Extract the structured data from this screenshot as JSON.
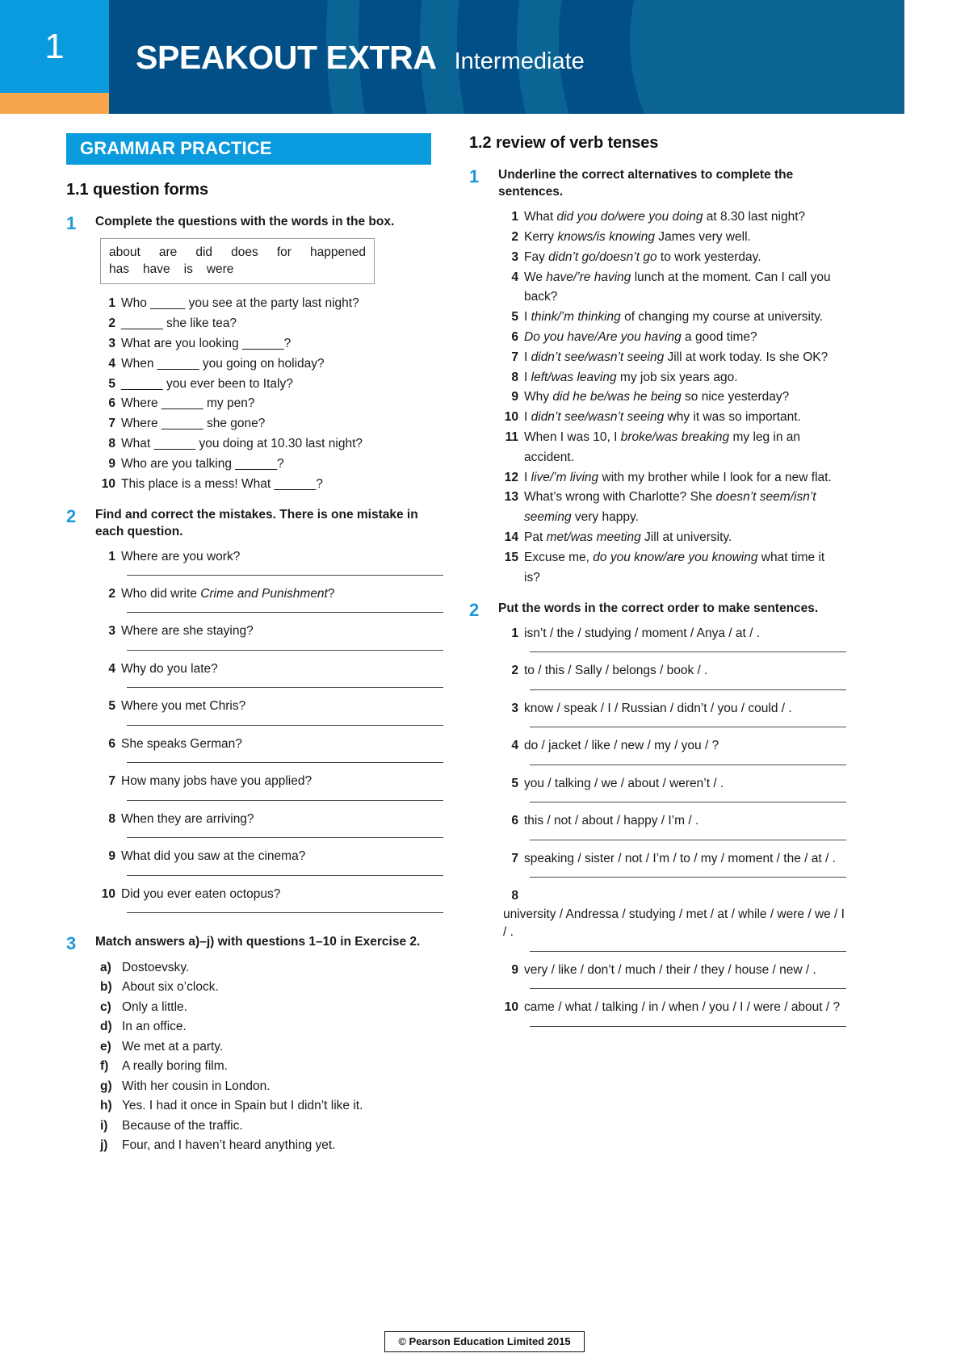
{
  "header": {
    "chapter_number": "1",
    "brand": "SPEAKOUT EXTRA",
    "level": "Intermediate",
    "accent_blue": "#0a9ade",
    "header_blue": "#014f86",
    "accent_orange": "#f7a64b"
  },
  "left_column": {
    "banner": "GRAMMAR PRACTICE",
    "unit_title": "1.1 question forms",
    "exercise1": {
      "number": "1",
      "instruction": "Complete the questions with the words in the box.",
      "wordbox_row1": [
        "about",
        "are",
        "did",
        "does",
        "for",
        "happened"
      ],
      "wordbox_row2": [
        "has",
        "have",
        "is",
        "were"
      ],
      "items": [
        {
          "n": "1",
          "text": "Who _____ you see at the party last night?"
        },
        {
          "n": "2",
          "text": "______ she like tea?"
        },
        {
          "n": "3",
          "text": "What are you looking ______?"
        },
        {
          "n": "4",
          "text": "When ______ you going on holiday?"
        },
        {
          "n": "5",
          "text": "______ you ever been to Italy?"
        },
        {
          "n": "6",
          "text": "Where ______ my pen?"
        },
        {
          "n": "7",
          "text": "Where ______ she gone?"
        },
        {
          "n": "8",
          "text": "What ______ you doing at 10.30 last night?"
        },
        {
          "n": "9",
          "text": "Who are you talking ______?"
        },
        {
          "n": "10",
          "text": "This place is a mess! What ______?"
        }
      ]
    },
    "exercise2": {
      "number": "2",
      "instruction": "Find and correct the mistakes. There is one mistake in each question.",
      "items": [
        {
          "n": "1",
          "text": "Where are you work?"
        },
        {
          "n": "2",
          "text": "Who did write ",
          "italic": "Crime and Punishment",
          "tail": "?"
        },
        {
          "n": "3",
          "text": "Where are she staying?"
        },
        {
          "n": "4",
          "text": "Why do you late?"
        },
        {
          "n": "5",
          "text": "Where you met Chris?"
        },
        {
          "n": "6",
          "text": "She speaks German?"
        },
        {
          "n": "7",
          "text": "How many jobs have you applied?"
        },
        {
          "n": "8",
          "text": "When they are arriving?"
        },
        {
          "n": "9",
          "text": "What did you saw at the cinema?"
        },
        {
          "n": "10",
          "text": "Did you ever eaten octopus?"
        }
      ]
    },
    "exercise3": {
      "number": "3",
      "instruction": "Match answers a)–j) with questions 1–10 in Exercise 2.",
      "items": [
        {
          "n": "a)",
          "text": "Dostoevsky."
        },
        {
          "n": "b)",
          "text": "About six o’clock."
        },
        {
          "n": "c)",
          "text": "Only a little."
        },
        {
          "n": "d)",
          "text": "In an office."
        },
        {
          "n": "e)",
          "text": "We met at a party."
        },
        {
          "n": "f)",
          "text": "A really boring film."
        },
        {
          "n": "g)",
          "text": "With her cousin in London."
        },
        {
          "n": "h)",
          "text": "Yes. I had it once in Spain but I didn’t like it."
        },
        {
          "n": "i)",
          "text": "Because of the traffic."
        },
        {
          "n": "j)",
          "text": "Four, and I haven’t heard anything yet."
        }
      ]
    }
  },
  "right_column": {
    "unit_title": "1.2 review of verb tenses",
    "exercise1": {
      "number": "1",
      "instruction": "Underline the correct alternatives to complete the sentences.",
      "items": [
        {
          "n": "1",
          "pre": "What ",
          "italic": "did you do/were you doing",
          "post": " at 8.30 last night?"
        },
        {
          "n": "2",
          "pre": "Kerry ",
          "italic": "knows/is knowing",
          "post": " James very well."
        },
        {
          "n": "3",
          "pre": "Fay ",
          "italic": "didn’t go/doesn’t go",
          "post": " to work yesterday."
        },
        {
          "n": "4",
          "pre": "We ",
          "italic": "have/’re having",
          "post": " lunch at the moment. Can I call you back?"
        },
        {
          "n": "5",
          "pre": "I ",
          "italic": "think/’m thinking",
          "post": " of changing my course at university."
        },
        {
          "n": "6",
          "pre": "",
          "italic": "Do you have/Are you having",
          "post": " a good time?"
        },
        {
          "n": "7",
          "pre": "I ",
          "italic": "didn’t see/wasn’t seeing",
          "post": " Jill at work today. Is she OK?"
        },
        {
          "n": "8",
          "pre": "I ",
          "italic": "left/was leaving",
          "post": " my job six years ago."
        },
        {
          "n": "9",
          "pre": "Why ",
          "italic": "did he be/was he being",
          "post": " so nice yesterday?"
        },
        {
          "n": "10",
          "pre": "I ",
          "italic": "didn’t see/wasn’t seeing",
          "post": " why it was so important."
        },
        {
          "n": "11",
          "pre": "When I was 10, I ",
          "italic": "broke/was breaking",
          "post": " my leg in an accident."
        },
        {
          "n": "12",
          "pre": "I ",
          "italic": "live/’m living",
          "post": " with my brother while I look for a new flat."
        },
        {
          "n": "13",
          "pre": "What’s wrong with Charlotte? She ",
          "italic": "doesn’t seem/isn’t seeming",
          "post": " very happy."
        },
        {
          "n": "14",
          "pre": "Pat ",
          "italic": "met/was meeting",
          "post": " Jill at university."
        },
        {
          "n": "15",
          "pre": "Excuse me, ",
          "italic": "do you know/are you knowing",
          "post": " what time it is?"
        }
      ]
    },
    "exercise2": {
      "number": "2",
      "instruction": "Put the words in the correct order to make sentences.",
      "items": [
        {
          "n": "1",
          "text": "isn’t / the / studying / moment / Anya / at / ."
        },
        {
          "n": "2",
          "text": "to / this / Sally / belongs / book / ."
        },
        {
          "n": "3",
          "text": "know / speak / I / Russian / didn’t / you / could / ."
        },
        {
          "n": "4",
          "text": "do / jacket / like / new / my / you / ?"
        },
        {
          "n": "5",
          "text": "you / talking / we / about / weren’t / ."
        },
        {
          "n": "6",
          "text": "this / not / about / happy / I’m / ."
        },
        {
          "n": "7",
          "text": "speaking / sister / not / I’m / to / my / moment / the / at / ."
        },
        {
          "n": "8",
          "text": "university / Andressa / studying / met / at / while / were / we / I / ."
        },
        {
          "n": "9",
          "text": "very / like / don’t / much / their / they / house / new / ."
        },
        {
          "n": "10",
          "text": "came / what / talking / in / when / you / I / were / about / ?"
        }
      ]
    }
  },
  "footer": {
    "copyright": "© Pearson Education Limited 2015"
  }
}
